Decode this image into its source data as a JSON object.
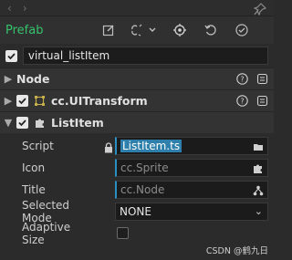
{
  "toolbar": {
    "prefab_label": "Prefab"
  },
  "node_name": {
    "value": "virtual_listItem",
    "enabled": true
  },
  "sections": {
    "node": {
      "title": "Node"
    },
    "uitransform": {
      "title": "cc.UITransform",
      "enabled": true
    },
    "listitem": {
      "title": "ListItem",
      "enabled": true
    }
  },
  "props": {
    "script": {
      "label": "Script",
      "value": "ListItem.ts"
    },
    "icon": {
      "label": "Icon",
      "placeholder": "cc.Sprite"
    },
    "title": {
      "label": "Title",
      "placeholder": "cc.Node"
    },
    "selected_mode": {
      "label": "Selected Mode",
      "value": "NONE"
    },
    "adaptive_size": {
      "label": "Adaptive Size",
      "checked": false
    }
  },
  "watermark": "CSDN @鹤九日",
  "colors": {
    "prefab_green": "#36c26b",
    "asset_accent": "#2a8fc3",
    "background": "#2b2b2b"
  }
}
